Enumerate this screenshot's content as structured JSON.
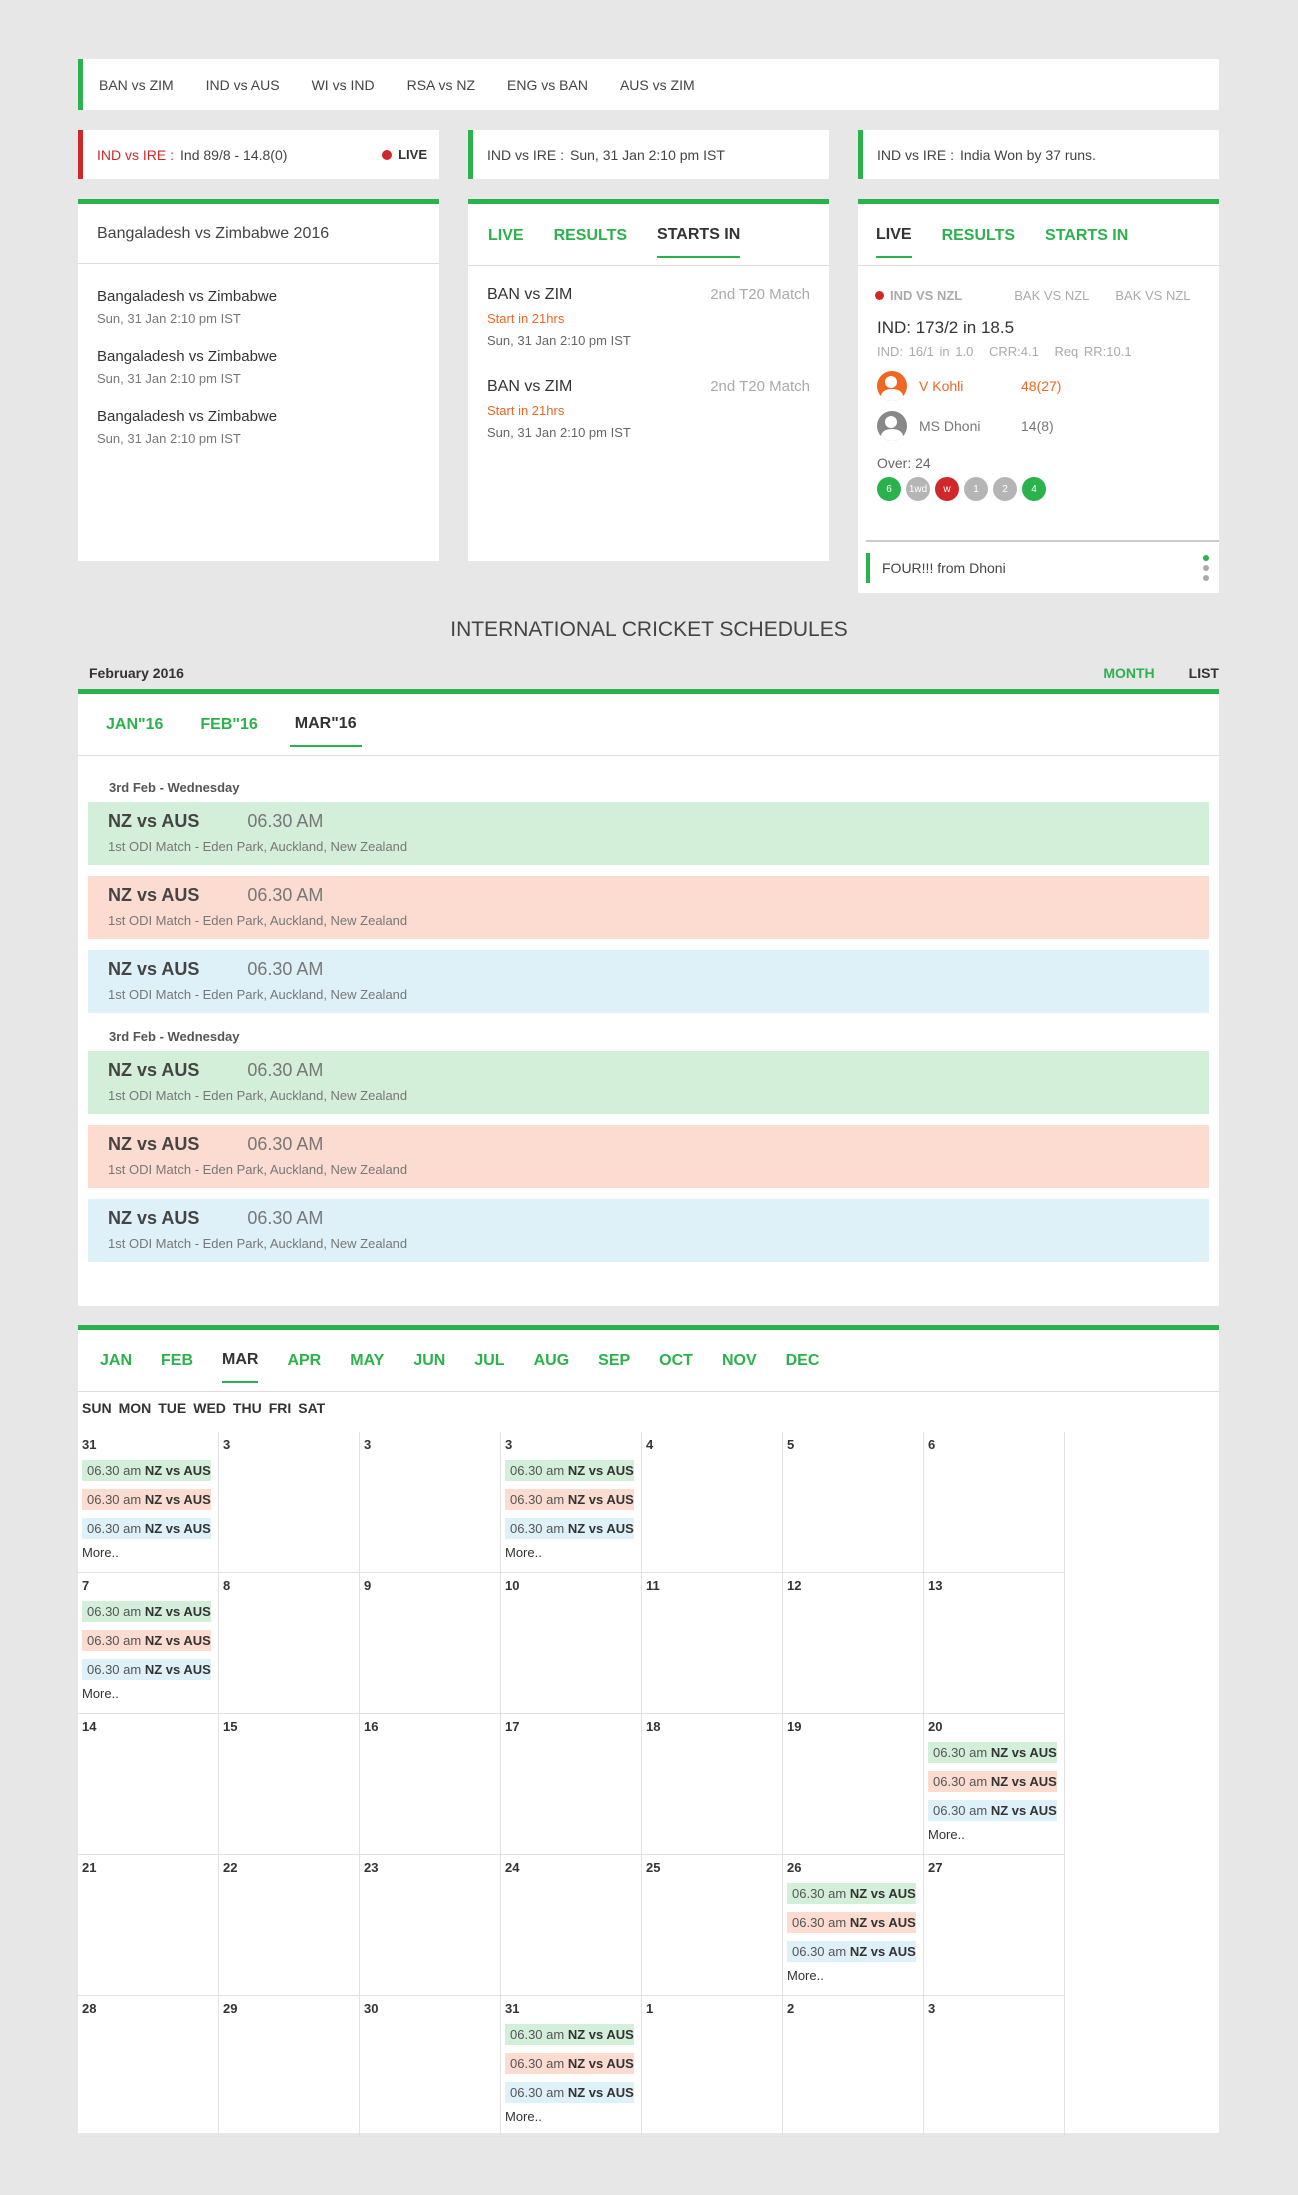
{
  "top_matches": [
    "BAN vs ZIM",
    "IND vs AUS",
    "WI vs IND",
    "RSA vs NZ",
    "ENG vs BAN",
    "AUS vs ZIM"
  ],
  "tickers": [
    {
      "label": "IND vs IRE :",
      "text": "Ind 89/8 - 14.8(0)",
      "live": "LIVE"
    },
    {
      "label": "IND vs IRE :",
      "text": "Sun, 31 Jan 2:10 pm IST"
    },
    {
      "label": "IND vs IRE :",
      "text": "India Won by 37 runs."
    }
  ],
  "series_card": {
    "title": "Bangaladesh vs Zimbabwe 2016",
    "items": [
      {
        "title": "Bangaladesh vs Zimbabwe",
        "sub": "Sun, 31 Jan 2:10 pm IST"
      },
      {
        "title": "Bangaladesh vs Zimbabwe",
        "sub": "Sun, 31 Jan 2:10 pm IST"
      },
      {
        "title": "Bangaladesh vs Zimbabwe",
        "sub": "Sun, 31 Jan 2:10 pm IST"
      }
    ]
  },
  "upcoming_card": {
    "tabs": [
      "LIVE",
      "RESULTS",
      "STARTS IN"
    ],
    "items": [
      {
        "teams": "BAN vs ZIM",
        "match": "2nd T20 Match",
        "starts": "Start in 21hrs",
        "date": "Sun, 31 Jan 2:10 pm IST"
      },
      {
        "teams": "BAN vs ZIM",
        "match": "2nd T20 Match",
        "starts": "Start in 21hrs",
        "date": "Sun, 31 Jan 2:10 pm IST"
      }
    ]
  },
  "live_card": {
    "tabs": [
      "LIVE",
      "RESULTS",
      "STARTS IN"
    ],
    "matches": [
      "IND VS NZL",
      "BAK VS NZL",
      "BAK VS NZL"
    ],
    "score": "IND: 173/2 in 18.5",
    "sub": [
      "IND: 16/1 in 1.0",
      "CRR:4.1",
      "Req RR:10.1"
    ],
    "batsmen": [
      {
        "name": "V Kohli",
        "runs": "48(27)"
      },
      {
        "name": "MS Dhoni",
        "runs": "14(8)"
      }
    ],
    "over_label": "Over: 24",
    "balls": [
      "6",
      "1wd",
      "w",
      "1",
      "2",
      "4"
    ],
    "commentary": "FOUR!!! from Dhoni"
  },
  "schedules": {
    "title": "INTERNATIONAL CRICKET SCHEDULES",
    "month": "February 2016",
    "views": [
      "MONTH",
      "LIST"
    ],
    "tabs": [
      "JAN\"16",
      "FEB\"16",
      "MAR\"16"
    ],
    "groups": [
      {
        "day": "3rd Feb - Wednesday",
        "events": [
          {
            "teams": "NZ vs AUS",
            "time": "06.30 AM",
            "venue": "1st ODI Match - Eden Park, Auckland, New Zealand"
          },
          {
            "teams": "NZ vs AUS",
            "time": "06.30 AM",
            "venue": "1st ODI Match - Eden Park, Auckland, New Zealand"
          },
          {
            "teams": "NZ vs AUS",
            "time": "06.30 AM",
            "venue": "1st ODI Match - Eden Park, Auckland, New Zealand"
          }
        ]
      },
      {
        "day": "3rd Feb - Wednesday",
        "events": [
          {
            "teams": "NZ vs AUS",
            "time": "06.30 AM",
            "venue": "1st ODI Match - Eden Park, Auckland, New Zealand"
          },
          {
            "teams": "NZ vs AUS",
            "time": "06.30 AM",
            "venue": "1st ODI Match - Eden Park, Auckland, New Zealand"
          },
          {
            "teams": "NZ vs AUS",
            "time": "06.30 AM",
            "venue": "1st ODI Match - Eden Park, Auckland, New Zealand"
          }
        ]
      }
    ]
  },
  "calendar": {
    "months": [
      "JAN",
      "FEB",
      "MAR",
      "APR",
      "MAY",
      "JUN",
      "JUL",
      "AUG",
      "SEP",
      "OCT",
      "NOV",
      "DEC"
    ],
    "weekdays": [
      "SUN",
      "MON",
      "TUE",
      "WED",
      "THU",
      "FRI",
      "SAT"
    ],
    "event_time": "06.30 am",
    "event_teams": "NZ vs AUS",
    "more": "More..",
    "weeks": [
      [
        "31",
        "3",
        "3",
        "3",
        "4",
        "5",
        "6"
      ],
      [
        "7",
        "8",
        "9",
        "10",
        "11",
        "12",
        "13"
      ],
      [
        "14",
        "15",
        "16",
        "17",
        "18",
        "19",
        "20"
      ],
      [
        "21",
        "22",
        "23",
        "24",
        "25",
        "26",
        "27"
      ],
      [
        "28",
        "29",
        "30",
        "31",
        "1",
        "2",
        "3"
      ]
    ],
    "event_cells": [
      "0-0",
      "0-3",
      "1-0",
      "2-6",
      "3-5",
      "4-3"
    ]
  }
}
